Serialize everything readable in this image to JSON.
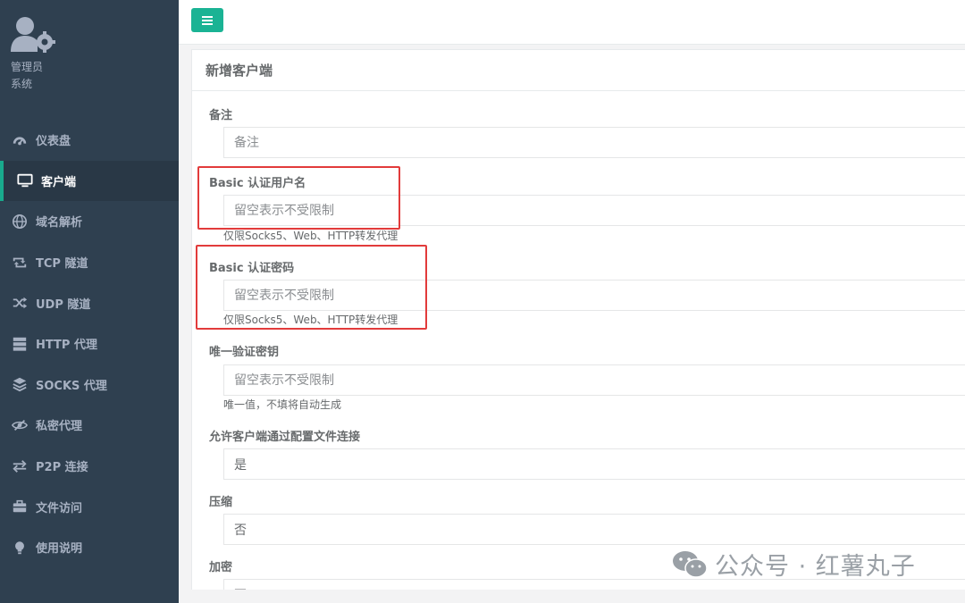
{
  "profile": {
    "name": "管理员",
    "role": "系统"
  },
  "nav": [
    {
      "label": "仪表盘",
      "icon": "dashboard-icon"
    },
    {
      "label": "客户端",
      "icon": "monitor-icon",
      "active": true
    },
    {
      "label": "域名解析",
      "icon": "globe-icon"
    },
    {
      "label": "TCP 隧道",
      "icon": "retweet-icon"
    },
    {
      "label": "UDP 隧道",
      "icon": "shuffle-icon"
    },
    {
      "label": "HTTP 代理",
      "icon": "server-icon"
    },
    {
      "label": "SOCKS 代理",
      "icon": "layers-icon"
    },
    {
      "label": "私密代理",
      "icon": "eye-slash-icon"
    },
    {
      "label": "P2P 连接",
      "icon": "exchange-icon"
    },
    {
      "label": "文件访问",
      "icon": "briefcase-icon"
    },
    {
      "label": "使用说明",
      "icon": "lightbulb-icon"
    }
  ],
  "form": {
    "title": "新增客户端",
    "remark": {
      "label": "备注",
      "placeholder": "备注"
    },
    "basic_user": {
      "label": "Basic 认证用户名",
      "placeholder": "留空表示不受限制",
      "help": "仅限Socks5、Web、HTTP转发代理"
    },
    "basic_pass": {
      "label": "Basic 认证密码",
      "placeholder": "留空表示不受限制",
      "help": "仅限Socks5、Web、HTTP转发代理"
    },
    "vkey": {
      "label": "唯一验证密钥",
      "placeholder": "留空表示不受限制",
      "help": "唯一值，不填将自动生成"
    },
    "config_conn": {
      "label": "允许客户端通过配置文件连接",
      "value": "是"
    },
    "compress": {
      "label": "压缩",
      "value": "否"
    },
    "encrypt": {
      "label": "加密",
      "value": "否"
    }
  },
  "watermark": {
    "text": "公众号 · 红薯丸子"
  },
  "colors": {
    "sidebar": "#2f4050",
    "accent": "#1ab394",
    "annotation": "#e23b3b"
  }
}
